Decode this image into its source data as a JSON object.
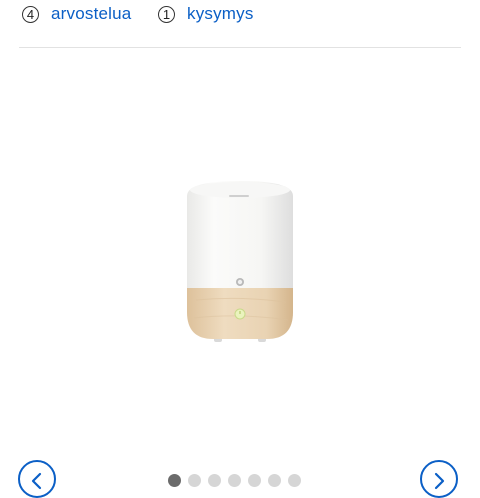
{
  "meta": {
    "reviews": {
      "count": "4",
      "label": "arvostelua"
    },
    "questions": {
      "count": "1",
      "label": "kysymys"
    }
  },
  "gallery": {
    "image_alt": "white and wood aroma diffuser",
    "slide_count": 7,
    "active_index": 0,
    "prev_icon": "chevron-left-icon",
    "next_icon": "chevron-right-icon"
  },
  "colors": {
    "accent": "#0b5fc6",
    "dot_active": "#6b6b6b",
    "dot_inactive": "#d6d6d6",
    "divider": "#e2e2e2"
  }
}
